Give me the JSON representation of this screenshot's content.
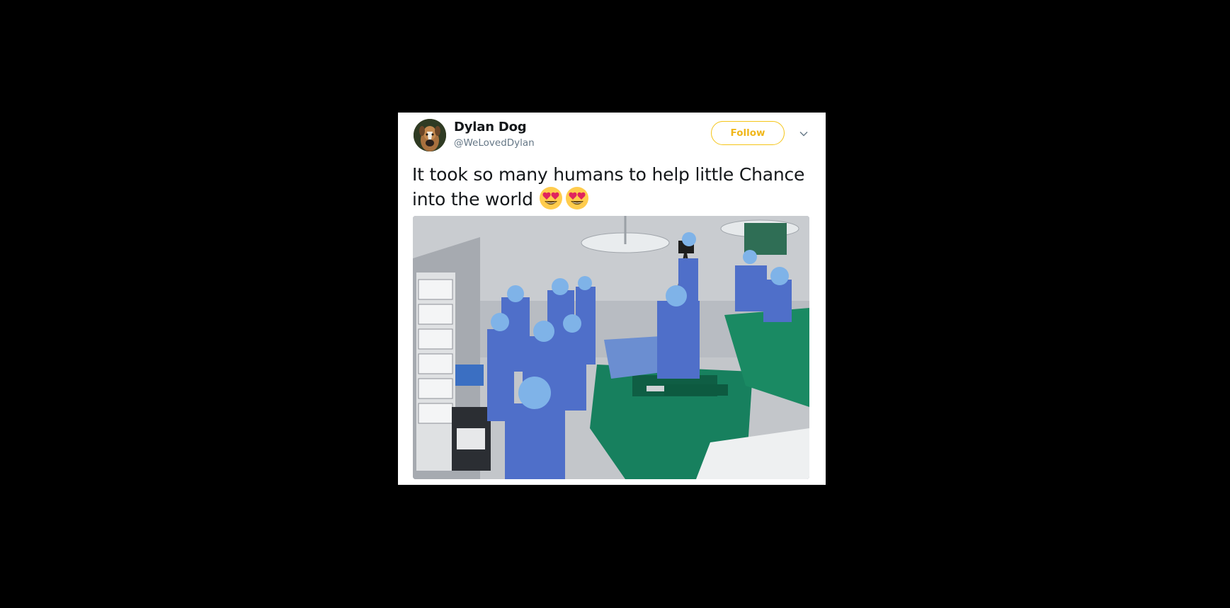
{
  "tweet": {
    "author": {
      "display_name": "Dylan Dog",
      "handle": "@WeLovedDylan",
      "avatar_icon": "boxer-dog-avatar"
    },
    "follow_label": "Follow",
    "text": "It took so many humans to help little Chance into the world",
    "emojis": [
      "heart-eyes-emoji",
      "heart-eyes-emoji"
    ],
    "media_image": "surgical-team-operating-room-photo",
    "more_icon": "chevron-down-icon"
  },
  "colors": {
    "background": "#000000",
    "card": "#ffffff",
    "follow_accent": "#f0b71b",
    "name": "#14171a",
    "handle": "#657786"
  }
}
